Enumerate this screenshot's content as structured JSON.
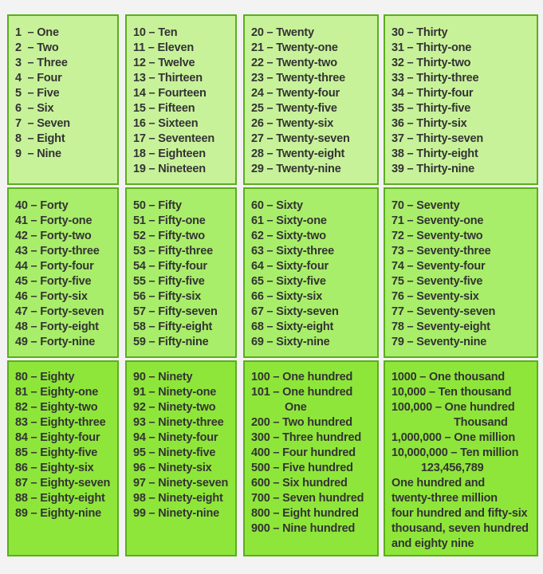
{
  "boxes": [
    {
      "row": 0,
      "col": 0,
      "lines": [
        "1  – One",
        "2  – Two",
        "3  – Three",
        "4  – Four",
        "5  – Five",
        "6  – Six",
        "7  – Seven",
        "8  – Eight",
        "9  – Nine"
      ]
    },
    {
      "row": 0,
      "col": 1,
      "lines": [
        "10 – Ten",
        "11 – Eleven",
        "12 – Twelve",
        "13 – Thirteen",
        "14 – Fourteen",
        "15 – Fifteen",
        "16 – Sixteen",
        "17 – Seventeen",
        "18 – Eighteen",
        "19 – Nineteen"
      ]
    },
    {
      "row": 0,
      "col": 2,
      "lines": [
        "20 – Twenty",
        "21 – Twenty-one",
        "22 – Twenty-two",
        "23 – Twenty-three",
        "24 – Twenty-four",
        "25 – Twenty-five",
        "26 – Twenty-six",
        "27 – Twenty-seven",
        "28 – Twenty-eight",
        "29 – Twenty-nine"
      ]
    },
    {
      "row": 0,
      "col": 3,
      "lines": [
        "30 – Thirty",
        "31 – Thirty-one",
        "32 – Thirty-two",
        "33 – Thirty-three",
        "34 – Thirty-four",
        "35 – Thirty-five",
        "36 – Thirty-six",
        "37 – Thirty-seven",
        "38 – Thirty-eight",
        "39 – Thirty-nine"
      ]
    },
    {
      "row": 1,
      "col": 0,
      "lines": [
        "40 – Forty",
        "41 – Forty-one",
        "42 – Forty-two",
        "43 – Forty-three",
        "44 – Forty-four",
        "45 – Forty-five",
        "46 – Forty-six",
        "47 – Forty-seven",
        "48 – Forty-eight",
        "49 – Forty-nine"
      ]
    },
    {
      "row": 1,
      "col": 1,
      "lines": [
        "50 – Fifty",
        "51 – Fifty-one",
        "52 – Fifty-two",
        "53 – Fifty-three",
        "54 – Fifty-four",
        "55 – Fifty-five",
        "56 – Fifty-six",
        "57 – Fifty-seven",
        "58 – Fifty-eight",
        "59 – Fifty-nine"
      ]
    },
    {
      "row": 1,
      "col": 2,
      "lines": [
        "60 – Sixty",
        "61 – Sixty-one",
        "62 – Sixty-two",
        "63 – Sixty-three",
        "64 – Sixty-four",
        "65 – Sixty-five",
        "66 – Sixty-six",
        "67 – Sixty-seven",
        "68 – Sixty-eight",
        "69 – Sixty-nine"
      ]
    },
    {
      "row": 1,
      "col": 3,
      "lines": [
        "70 – Seventy",
        "71 – Seventy-one",
        "72 – Seventy-two",
        "73 – Seventy-three",
        "74 – Seventy-four",
        "75 – Seventy-five",
        "76 – Seventy-six",
        "77 – Seventy-seven",
        "78 – Seventy-eight",
        "79 – Seventy-nine"
      ]
    },
    {
      "row": 2,
      "col": 0,
      "lines": [
        "80 – Eighty",
        "81 – Eighty-one",
        "82 – Eighty-two",
        "83 – Eighty-three",
        "84 – Eighty-four",
        "85 – Eighty-five",
        "86 – Eighty-six",
        "87 – Eighty-seven",
        "88 – Eighty-eight",
        "89 – Eighty-nine"
      ]
    },
    {
      "row": 2,
      "col": 1,
      "lines": [
        "90 – Ninety",
        "91 – Ninety-one",
        "92 – Ninety-two",
        "93 – Ninety-three",
        "94 – Ninety-four",
        "95 – Ninety-five",
        "96 – Ninety-six",
        "97 – Ninety-seven",
        "98 – Ninety-eight",
        "99 – Ninety-nine"
      ]
    },
    {
      "row": 2,
      "col": 2,
      "lines": [
        "100 – One hundred",
        "101 – One hundred",
        "One",
        "200 – Two hundred",
        "300 – Three hundred",
        "400 – Four hundred",
        "500 – Five hundred",
        "600 – Six hundred",
        "700 – Seven hundred",
        "800 – Eight hundred",
        "900 – Nine hundred"
      ]
    },
    {
      "row": 2,
      "col": 3,
      "lines": [
        "1000 – One thousand",
        "10,000 – Ten thousand",
        "100,000 – One hundred",
        "Thousand",
        "1,000,000 – One million",
        "10,000,000 – Ten million",
        "123,456,789",
        "One hundred and",
        "twenty-three million",
        "four hundred and fifty-six",
        "thousand, seven hundred",
        "and eighty nine"
      ]
    }
  ],
  "colors": {
    "row0_bg": "#c8f29a",
    "row1_bg": "#a9ee6a",
    "row2_bg": "#8fe63a",
    "border": "#5aae1c",
    "text": "#333333",
    "page_bg": "#f3f3f3"
  }
}
